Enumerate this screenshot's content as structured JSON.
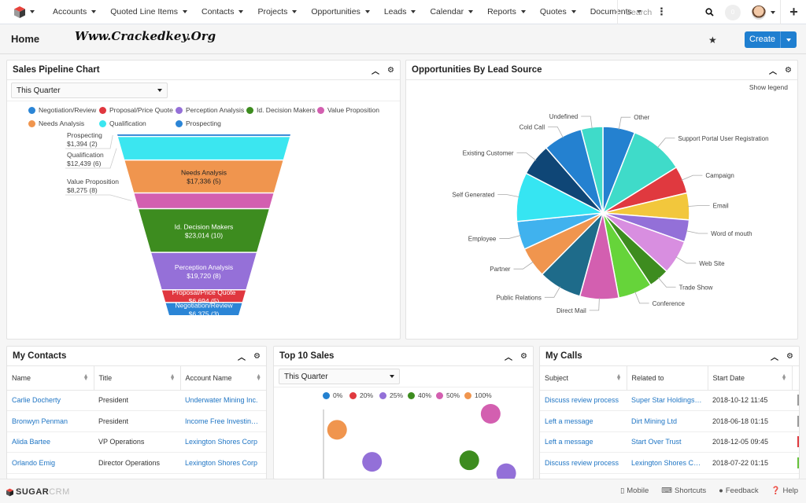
{
  "navbar": {
    "nav_items": [
      "Accounts",
      "Quoted Line Items",
      "Contacts",
      "Projects",
      "Opportunities",
      "Leads",
      "Calendar",
      "Reports",
      "Quotes",
      "Documents"
    ],
    "more_icon": "vertical-ellipsis-icon",
    "search_placeholder": "Search",
    "notification_count": "0",
    "plus_icon": "+"
  },
  "subheader": {
    "title": "Home",
    "watermark": "Www.Crackedkey.Org",
    "create_label": "Create",
    "favorite_icon": "★"
  },
  "pipeline": {
    "title": "Sales Pipeline Chart",
    "filter": "This Quarter",
    "legend": [
      {
        "label": "Negotiation/Review",
        "color": "#2b85d6"
      },
      {
        "label": "Proposal/Price Quote",
        "color": "#e0373f"
      },
      {
        "label": "Perception Analysis",
        "color": "#9570d8"
      },
      {
        "label": "Id. Decision Makers",
        "color": "#3d8c1f"
      },
      {
        "label": "Value Proposition",
        "color": "#d35fb0"
      },
      {
        "label": "Needs Analysis",
        "color": "#f0954e"
      },
      {
        "label": "Qualification",
        "color": "#3be6f0"
      },
      {
        "label": "Prospecting",
        "color": "#2b85d6"
      }
    ]
  },
  "chart_data": [
    {
      "type": "funnel",
      "title": "Sales Pipeline Chart",
      "stages": [
        {
          "label": "Prospecting",
          "amount": "$1,394",
          "count": 2,
          "value": 1394,
          "color": "#2b85d6",
          "label_outside": true
        },
        {
          "label": "Qualification",
          "amount": "$12,439",
          "count": 6,
          "value": 12439,
          "color": "#3be6f0",
          "label_outside": true
        },
        {
          "label": "Needs Analysis",
          "amount": "$17,336",
          "count": 5,
          "value": 17336,
          "color": "#f0954e",
          "label_outside": false
        },
        {
          "label": "Value Proposition",
          "amount": "$8,275",
          "count": 8,
          "value": 8275,
          "color": "#d35fb0",
          "label_outside": true
        },
        {
          "label": "Id. Decision Makers",
          "amount": "$23,014",
          "count": 10,
          "value": 23014,
          "color": "#3d8c1f",
          "label_outside": false
        },
        {
          "label": "Perception Analysis",
          "amount": "$19,720",
          "count": 8,
          "value": 19720,
          "color": "#9570d8",
          "label_outside": false
        },
        {
          "label": "Proposal/Price Quote",
          "amount": "$6,694",
          "count": 5,
          "value": 6694,
          "color": "#e0373f",
          "label_outside": false
        },
        {
          "label": "Negotiation/Review",
          "amount": "$6,375",
          "count": 3,
          "value": 6375,
          "color": "#2b85d6",
          "label_outside": false
        }
      ]
    },
    {
      "type": "pie",
      "title": "Opportunities By Lead Source",
      "show_legend_label": "Show legend",
      "slices": [
        {
          "label": "Other",
          "value": 6.2,
          "color": "#2481d0"
        },
        {
          "label": "Support Portal User Registration",
          "value": 10.5,
          "color": "#3fdbc9"
        },
        {
          "label": "Campaign",
          "value": 5.3,
          "color": "#e0393f"
        },
        {
          "label": "Email",
          "value": 5.2,
          "color": "#f2c73c"
        },
        {
          "label": "Word of mouth",
          "value": 4.3,
          "color": "#9370d8"
        },
        {
          "label": "Web Site",
          "value": 6.6,
          "color": "#d88ee0"
        },
        {
          "label": "Trade Show",
          "value": 4.0,
          "color": "#3d8c1f"
        },
        {
          "label": "Conference",
          "value": 6.6,
          "color": "#66d43a"
        },
        {
          "label": "Direct Mail",
          "value": 7.5,
          "color": "#d35fb0"
        },
        {
          "label": "Public Relations",
          "value": 8.4,
          "color": "#1e6b8a"
        },
        {
          "label": "Partner",
          "value": 5.9,
          "color": "#f0954e"
        },
        {
          "label": "Employee",
          "value": 5.5,
          "color": "#40b2ee"
        },
        {
          "label": "Self Generated",
          "value": 9.5,
          "color": "#36e5f2"
        },
        {
          "label": "Existing Customer",
          "value": 6.2,
          "color": "#0f4676"
        },
        {
          "label": "Cold Call",
          "value": 7.6,
          "color": "#2481d0"
        },
        {
          "label": "Undefined",
          "value": 4.2,
          "color": "#3fdbc9"
        }
      ]
    },
    {
      "type": "scatter",
      "title": "Top 10 Sales",
      "legend": [
        {
          "label": "0%",
          "color": "#2481d0"
        },
        {
          "label": "20%",
          "color": "#e0393f"
        },
        {
          "label": "25%",
          "color": "#9370d8"
        },
        {
          "label": "40%",
          "color": "#3d8c1f"
        },
        {
          "label": "50%",
          "color": "#d35fb0"
        },
        {
          "label": "100%",
          "color": "#f0954e"
        }
      ],
      "points": [
        {
          "x": 0.09,
          "y": 0.62,
          "series": "100%"
        },
        {
          "x": 0.27,
          "y": 0.2,
          "series": "25%"
        },
        {
          "x": 0.77,
          "y": 0.22,
          "series": "40%"
        },
        {
          "x": 0.88,
          "y": 0.83,
          "series": "50%"
        },
        {
          "x": 0.96,
          "y": 0.05,
          "series": "25%"
        }
      ]
    }
  ],
  "top10": {
    "title": "Top 10 Sales",
    "filter": "This Quarter"
  },
  "contacts": {
    "title": "My Contacts",
    "columns": [
      "Name",
      "Title",
      "Account Name"
    ],
    "rows": [
      {
        "name": "Carlie Docherty",
        "title": "President",
        "account": "Underwater Mining Inc."
      },
      {
        "name": "Bronwyn Penman",
        "title": "President",
        "account": "Income Free Investing ..."
      },
      {
        "name": "Alida Bartee",
        "title": "VP Operations",
        "account": "Lexington Shores Corp"
      },
      {
        "name": "Orlando Emig",
        "title": "Director Operations",
        "account": "Lexington Shores Corp"
      }
    ]
  },
  "calls": {
    "title": "My Calls",
    "columns": [
      "Subject",
      "Related to",
      "Start Date"
    ],
    "rows": [
      {
        "subject": "Discuss review process",
        "related": "Super Star Holdings I...",
        "date": "2018-10-12 11:45",
        "status_color": "#999999"
      },
      {
        "subject": "Left a message",
        "related": "Dirt Mining Ltd",
        "date": "2018-06-18 01:15",
        "status_color": "#999999"
      },
      {
        "subject": "Left a message",
        "related": "Start Over Trust",
        "date": "2018-12-05 09:45",
        "status_color": "#e0393f"
      },
      {
        "subject": "Discuss review process",
        "related": "Lexington Shores Corp",
        "date": "2018-07-22 01:15",
        "status_color": "#66c23a"
      }
    ]
  },
  "footer": {
    "logo_sugar": "SUGAR",
    "logo_crm": "CRM",
    "links": [
      "Mobile",
      "Shortcuts",
      "Feedback",
      "Help"
    ]
  }
}
